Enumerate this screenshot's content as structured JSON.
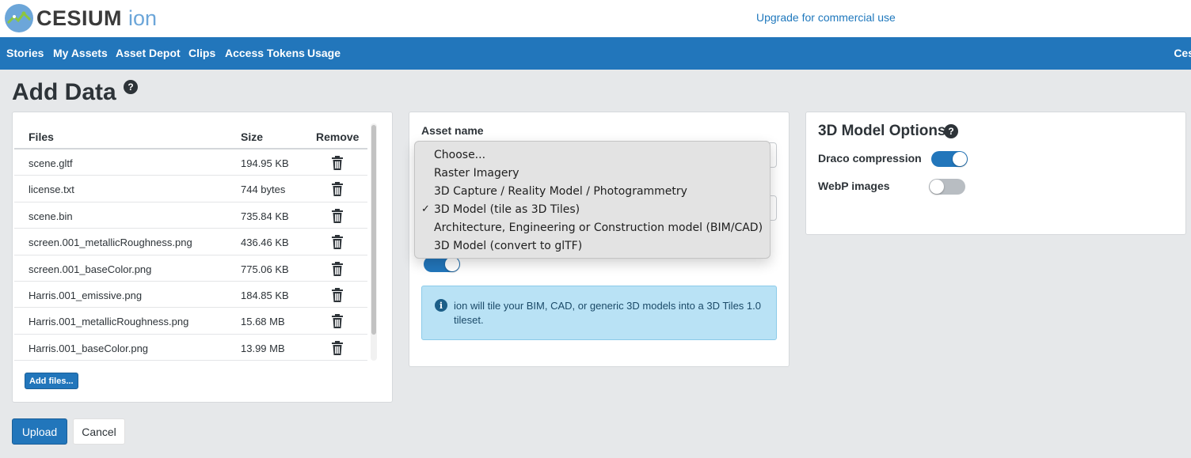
{
  "header": {
    "logo_word": "CESIUM",
    "logo_ion": "ion",
    "upgrade_link": "Upgrade for commercial use"
  },
  "nav": {
    "items": [
      "Stories",
      "My Assets",
      "Asset Depot",
      "Clips",
      "Access Tokens",
      "Usage"
    ],
    "right_truncated": "Ces"
  },
  "page": {
    "title": "Add Data"
  },
  "files": {
    "headers": {
      "name": "Files",
      "size": "Size",
      "remove": "Remove"
    },
    "rows": [
      {
        "name": "scene.gltf",
        "size": "194.95 KB"
      },
      {
        "name": "license.txt",
        "size": "744 bytes"
      },
      {
        "name": "scene.bin",
        "size": "735.84 KB"
      },
      {
        "name": "screen.001_metallicRoughness.png",
        "size": "436.46 KB"
      },
      {
        "name": "screen.001_baseColor.png",
        "size": "775.06 KB"
      },
      {
        "name": "Harris.001_emissive.png",
        "size": "184.85 KB"
      },
      {
        "name": "Harris.001_metallicRoughness.png",
        "size": "15.68 MB"
      },
      {
        "name": "Harris.001_baseColor.png",
        "size": "13.99 MB"
      }
    ],
    "add_button": "Add files..."
  },
  "asset": {
    "name_label": "Asset name",
    "type_options": [
      "Choose...",
      "Raster Imagery",
      "3D Capture / Reality Model / Photogrammetry",
      "3D Model (tile as 3D Tiles)",
      "Architecture, Engineering or Construction model (BIM/CAD)",
      "3D Model (convert to glTF)"
    ],
    "selected_index": 3,
    "checkmark": "✓",
    "info_text": "ion will tile your BIM, CAD, or generic 3D models into a 3D Tiles 1.0 tileset."
  },
  "options": {
    "title": "3D Model Options",
    "draco_label": "Draco compression",
    "draco_on": true,
    "webp_label": "WebP images",
    "webp_on": false
  },
  "actions": {
    "upload": "Upload",
    "cancel": "Cancel"
  },
  "colors": {
    "primary": "#2276bb",
    "info_bg": "#b9e2f5",
    "logo_blue": "#6ca6d9"
  }
}
